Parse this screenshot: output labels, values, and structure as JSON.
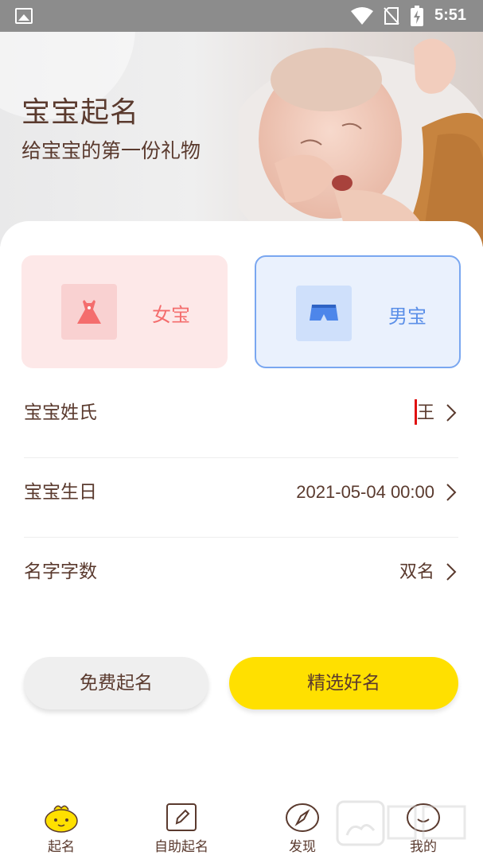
{
  "status_bar": {
    "time": "5:51"
  },
  "banner": {
    "title": "宝宝起名",
    "subtitle": "给宝宝的第一份礼物"
  },
  "gender": {
    "girl_label": "女宝",
    "boy_label": "男宝",
    "girl_color": "#f46d6d",
    "boy_color": "#5b8fe8"
  },
  "form": {
    "surname": {
      "label": "宝宝姓氏",
      "value": "王"
    },
    "birthday": {
      "label": "宝宝生日",
      "value": "2021-05-04 00:00"
    },
    "name_length": {
      "label": "名字字数",
      "value": "双名"
    }
  },
  "buttons": {
    "free": "免费起名",
    "pick": "精选好名",
    "pick_color": "#ffe000"
  },
  "bottom_nav": [
    {
      "label": "起名",
      "icon": "baby-face-icon"
    },
    {
      "label": "自助起名",
      "icon": "edit-icon"
    },
    {
      "label": "发现",
      "icon": "compass-icon"
    },
    {
      "label": "我的",
      "icon": "profile-icon"
    }
  ]
}
